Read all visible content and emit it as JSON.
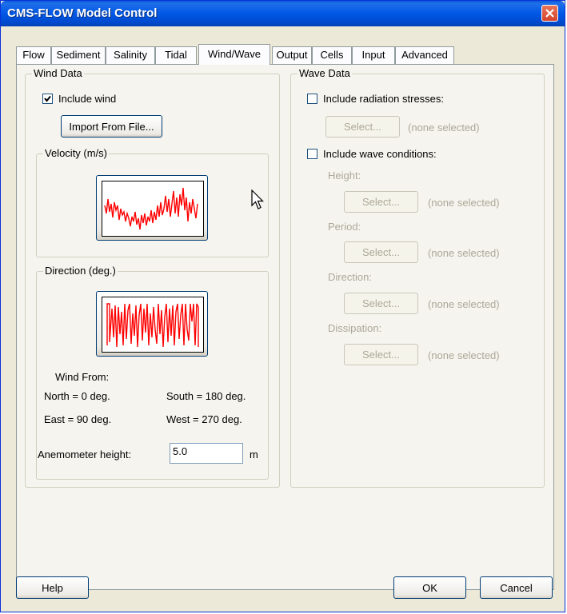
{
  "window": {
    "title": "CMS-FLOW Model Control"
  },
  "tabs": [
    {
      "label": "Flow"
    },
    {
      "label": "Sediment"
    },
    {
      "label": "Salinity"
    },
    {
      "label": "Tidal"
    },
    {
      "label": "Wind/Wave"
    },
    {
      "label": "Output"
    },
    {
      "label": "Cells"
    },
    {
      "label": "Input"
    },
    {
      "label": "Advanced"
    }
  ],
  "active_tab": "Wind/Wave",
  "wind": {
    "group_label": "Wind Data",
    "include_label": "Include wind",
    "include_checked": true,
    "import_label": "Import From File...",
    "velocity_label": "Velocity (m/s)",
    "direction_label": "Direction (deg.)",
    "wind_from": "Wind From:",
    "north": "North = 0 deg.",
    "south": "South = 180 deg.",
    "east": "East = 90 deg.",
    "west": "West = 270 deg.",
    "anemometer_label": "Anemometer height:",
    "anemometer_value": "5.0",
    "anemometer_unit": "m",
    "plot_color": "#ff0000"
  },
  "wave": {
    "group_label": "Wave Data",
    "radiation_label": "Include radiation stresses:",
    "radiation_checked": false,
    "wave_conditions_label": "Include wave conditions:",
    "wave_conditions_checked": false,
    "select_label": "Select...",
    "none_selected": "(none selected)",
    "height_label": "Height:",
    "period_label": "Period:",
    "direction_label": "Direction:",
    "dissipation_label": "Dissipation:"
  },
  "buttons": {
    "help": "Help",
    "ok": "OK",
    "cancel": "Cancel"
  }
}
